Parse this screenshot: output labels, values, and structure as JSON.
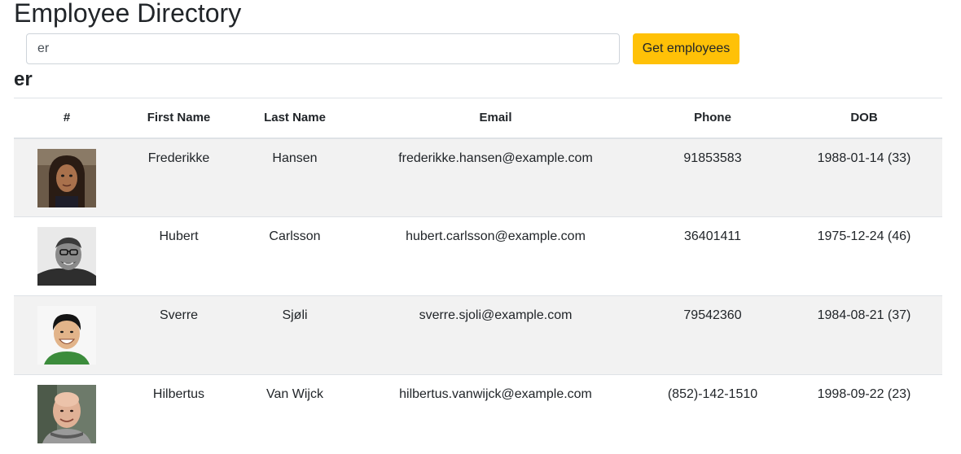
{
  "header": {
    "title": "Employee Directory"
  },
  "search": {
    "value": "er",
    "button_label": "Get employees"
  },
  "query_heading": "er",
  "table": {
    "columns": [
      "#",
      "First Name",
      "Last Name",
      "Email",
      "Phone",
      "DOB"
    ],
    "rows": [
      {
        "avatar": "avatar-woman-long-dark-hair",
        "first": "Frederikke",
        "last": "Hansen",
        "email": "frederikke.hansen@example.com",
        "phone": "91853583",
        "dob": "1988-01-14 (33)"
      },
      {
        "avatar": "avatar-man-glasses-bw",
        "first": "Hubert",
        "last": "Carlsson",
        "email": "hubert.carlsson@example.com",
        "phone": "36401411",
        "dob": "1975-12-24 (46)"
      },
      {
        "avatar": "avatar-man-smiling",
        "first": "Sverre",
        "last": "Sjøli",
        "email": "sverre.sjoli@example.com",
        "phone": "79542360",
        "dob": "1984-08-21 (37)"
      },
      {
        "avatar": "avatar-bald-man-scarf",
        "first": "Hilbertus",
        "last": "Van Wijck",
        "email": "hilbertus.vanwijck@example.com",
        "phone": "(852)-142-1510",
        "dob": "1998-09-22 (23)"
      }
    ]
  }
}
